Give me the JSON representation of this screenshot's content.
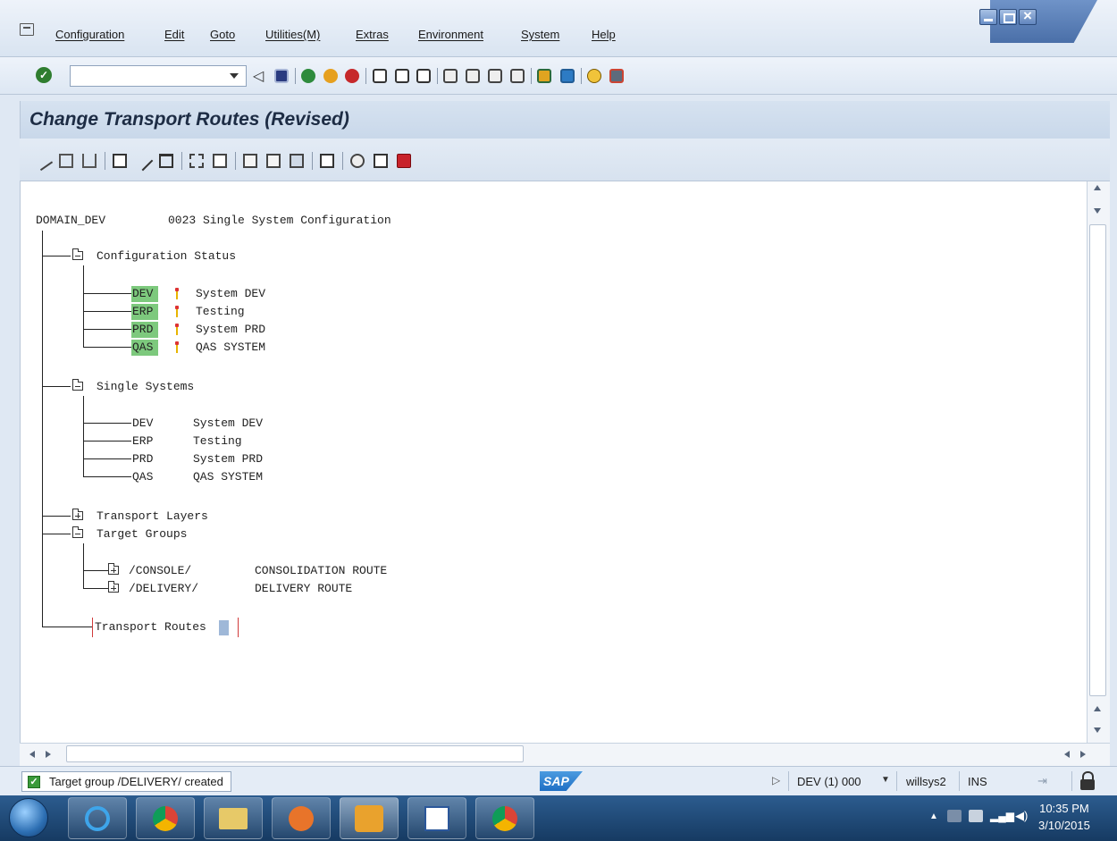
{
  "menu": {
    "items": [
      "Configuration",
      "Edit",
      "Goto",
      "Utilities(M)",
      "Extras",
      "Environment",
      "System",
      "Help"
    ]
  },
  "toolbar": {
    "command_field_value": ""
  },
  "page_title": "Change Transport Routes (Revised)",
  "tree": {
    "root_domain": "DOMAIN_DEV",
    "root_desc": "0023 Single System Configuration",
    "config_status": {
      "label": "Configuration Status",
      "systems": [
        {
          "sid": "DEV",
          "desc": "System DEV"
        },
        {
          "sid": "ERP",
          "desc": "Testing"
        },
        {
          "sid": "PRD",
          "desc": "System PRD"
        },
        {
          "sid": "QAS",
          "desc": "QAS SYSTEM"
        }
      ]
    },
    "single_systems": {
      "label": "Single Systems",
      "systems": [
        {
          "sid": "DEV",
          "desc": "System DEV"
        },
        {
          "sid": "ERP",
          "desc": "Testing"
        },
        {
          "sid": "PRD",
          "desc": "System PRD"
        },
        {
          "sid": "QAS",
          "desc": "QAS SYSTEM"
        }
      ]
    },
    "transport_layers": {
      "label": "Transport Layers"
    },
    "target_groups": {
      "label": "Target Groups",
      "groups": [
        {
          "name": "/CONSOLE/",
          "desc": "CONSOLIDATION ROUTE"
        },
        {
          "name": "/DELIVERY/",
          "desc": "DELIVERY ROUTE"
        }
      ]
    },
    "transport_routes": {
      "label": "Transport Routes"
    }
  },
  "status": {
    "message": "Target group /DELIVERY/ created",
    "sap_logo": "SAP",
    "system": "DEV (1) 000",
    "user": "willsys2",
    "mode": "INS"
  },
  "taskbar": {
    "time": "10:35 PM",
    "date": "3/10/2015"
  },
  "colors": {
    "highlight": "#7dc97d",
    "title_text": "#1d2c44",
    "selection_bracket": "#d03a3a"
  }
}
